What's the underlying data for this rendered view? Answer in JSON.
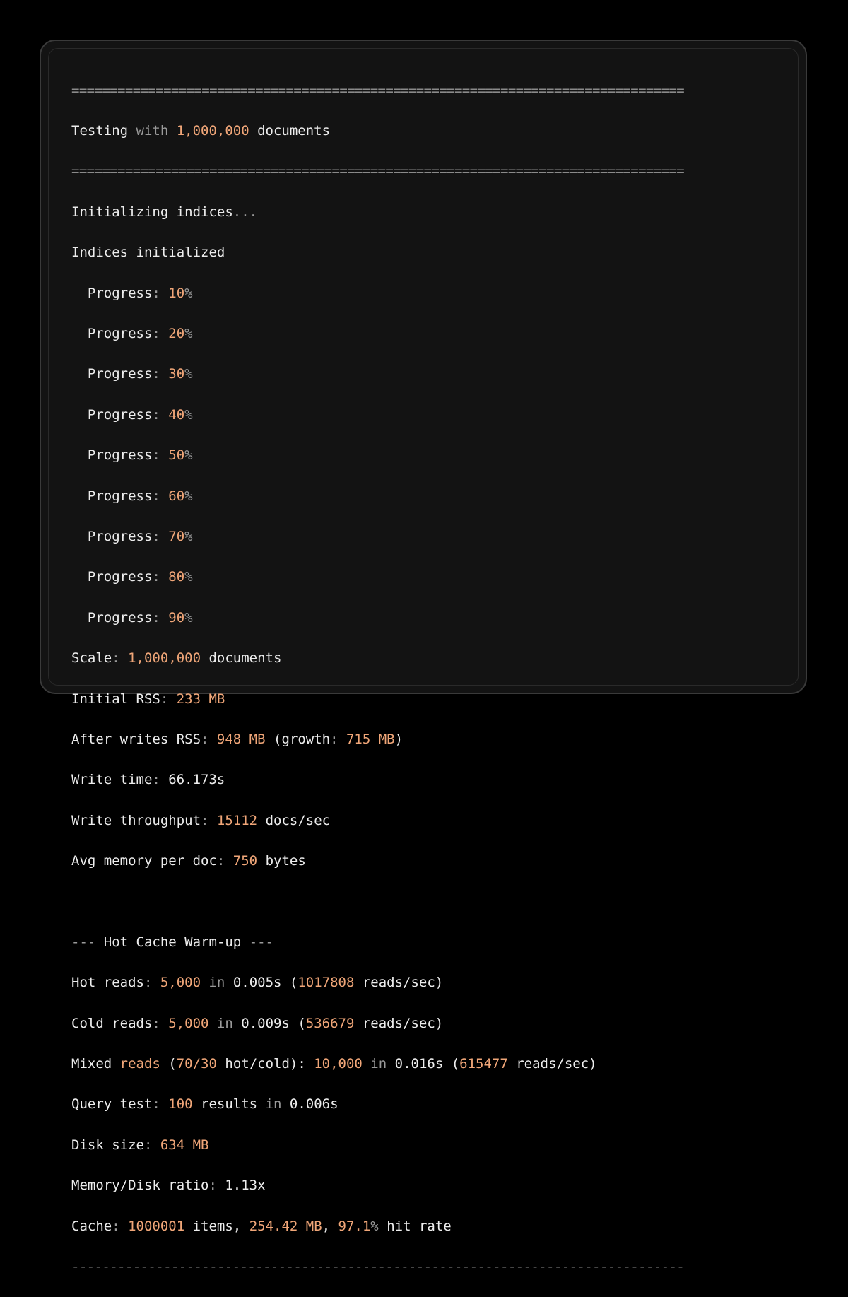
{
  "colors": {
    "background": "#000000",
    "window": "#131313",
    "text": "#ededed",
    "dim": "#9a9a9a",
    "number": "#f0a678",
    "separator": "#8a8a8a"
  },
  "lines": {
    "sep_top": "================================================================================",
    "testing": [
      "Testing",
      " with ",
      "1,000,000",
      " documents"
    ],
    "sep_mid": "================================================================================",
    "init": [
      "Initializing indices",
      "..."
    ],
    "init_done": "Indices initialized",
    "progress": [
      {
        "label": "  Progress",
        "colon": ": ",
        "value": "10",
        "pct": "%"
      },
      {
        "label": "  Progress",
        "colon": ": ",
        "value": "20",
        "pct": "%"
      },
      {
        "label": "  Progress",
        "colon": ": ",
        "value": "30",
        "pct": "%"
      },
      {
        "label": "  Progress",
        "colon": ": ",
        "value": "40",
        "pct": "%"
      },
      {
        "label": "  Progress",
        "colon": ": ",
        "value": "50",
        "pct": "%"
      },
      {
        "label": "  Progress",
        "colon": ": ",
        "value": "60",
        "pct": "%"
      },
      {
        "label": "  Progress",
        "colon": ": ",
        "value": "70",
        "pct": "%"
      },
      {
        "label": "  Progress",
        "colon": ": ",
        "value": "80",
        "pct": "%"
      },
      {
        "label": "  Progress",
        "colon": ": ",
        "value": "90",
        "pct": "%"
      }
    ],
    "scale": [
      "Scale",
      ": ",
      "1,000,000",
      " documents"
    ],
    "initial_rss": [
      "Initial RSS",
      ": ",
      "233 MB"
    ],
    "after_writes": [
      "After writes RSS",
      ": ",
      "948 MB",
      " (growth",
      ": ",
      "715 MB",
      ")"
    ],
    "write_time": [
      "Write time",
      ": ",
      "66.173s"
    ],
    "write_throughput": [
      "Write throughput",
      ": ",
      "15112",
      " docs/sec"
    ],
    "avg_memory": [
      "Avg memory per doc",
      ": ",
      "750",
      " bytes"
    ],
    "hot_cache_header": [
      "--- ",
      "Hot Cache Warm-up",
      " ---"
    ],
    "hot_reads": [
      "Hot reads",
      ": ",
      "5,000",
      " in ",
      "0.005s",
      " (",
      "1017808",
      " reads/sec)"
    ],
    "cold_reads": [
      "Cold reads",
      ": ",
      "5,000",
      " in ",
      "0.009s",
      " (",
      "536679",
      " reads/sec)"
    ],
    "mixed_reads": [
      "Mixed ",
      "reads",
      " (",
      "70/30",
      " hot/cold): ",
      "10,000",
      " in ",
      "0.016s",
      " (",
      "615477",
      " reads/sec)"
    ],
    "query_test": [
      "Query test",
      ": ",
      "100",
      " results",
      " in ",
      "0.006s"
    ],
    "disk_size": [
      "Disk size",
      ": ",
      "634 MB"
    ],
    "mem_disk_ratio": [
      "Memory/Disk ratio",
      ": ",
      "1.13x"
    ],
    "cache": [
      "Cache",
      ": ",
      "1000001",
      " items, ",
      "254.42 MB",
      ", ",
      "97.1",
      "%",
      " hit rate"
    ],
    "sep_bottom": "--------------------------------------------------------------------------------"
  }
}
